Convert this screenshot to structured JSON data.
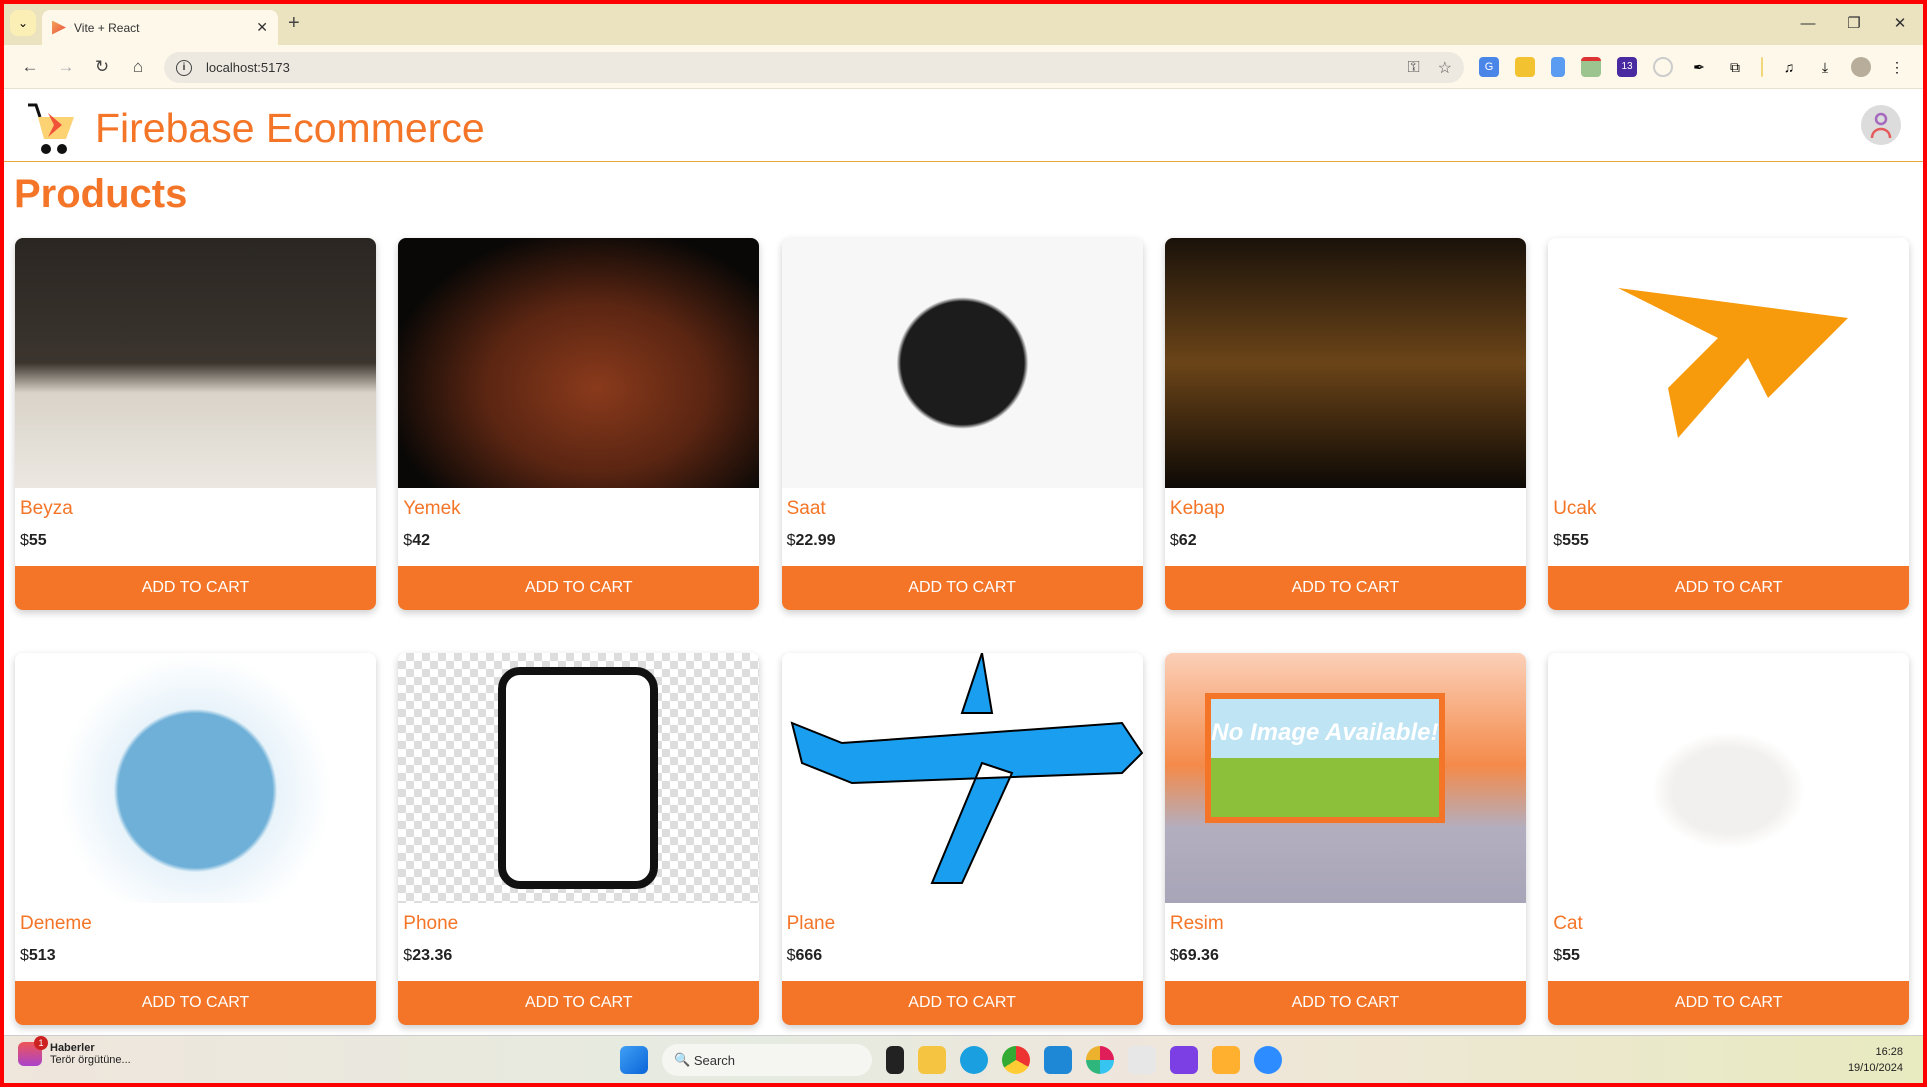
{
  "browser": {
    "tab_title": "Vite + React",
    "url": "localhost:5173",
    "extension_badge": "13"
  },
  "header": {
    "brand": "Firebase Ecommerce"
  },
  "page": {
    "title": "Products"
  },
  "products": [
    {
      "name": "Beyza",
      "currency": "$",
      "price": "55",
      "button": "ADD TO CART",
      "image": "bread"
    },
    {
      "name": "Yemek",
      "currency": "$",
      "price": "42",
      "button": "ADD TO CART",
      "image": "steak"
    },
    {
      "name": "Saat",
      "currency": "$",
      "price": "22.99",
      "button": "ADD TO CART",
      "image": "watch"
    },
    {
      "name": "Kebap",
      "currency": "$",
      "price": "62",
      "button": "ADD TO CART",
      "image": "restaurant"
    },
    {
      "name": "Ucak",
      "currency": "$",
      "price": "555",
      "button": "ADD TO CART",
      "image": "orange-plane"
    },
    {
      "name": "Deneme",
      "currency": "$",
      "price": "513",
      "button": "ADD TO CART",
      "image": "globe-plane"
    },
    {
      "name": "Phone",
      "currency": "$",
      "price": "23.36",
      "button": "ADD TO CART",
      "image": "phone"
    },
    {
      "name": "Plane",
      "currency": "$",
      "price": "666",
      "button": "ADD TO CART",
      "image": "blue-plane"
    },
    {
      "name": "Resim",
      "currency": "$",
      "price": "69.36",
      "button": "ADD TO CART",
      "image": "no-image"
    },
    {
      "name": "Cat",
      "currency": "$",
      "price": "55",
      "button": "ADD TO CART",
      "image": "cat"
    }
  ],
  "no_image_text": "No Image Available!",
  "taskbar": {
    "news_title": "Haberler",
    "news_sub": "Terör örgütüne...",
    "news_badge": "1",
    "search": "Search",
    "time": "16:28",
    "date": "19/10/2024"
  },
  "colors": {
    "accent": "#f47527",
    "border": "#ff0000"
  }
}
